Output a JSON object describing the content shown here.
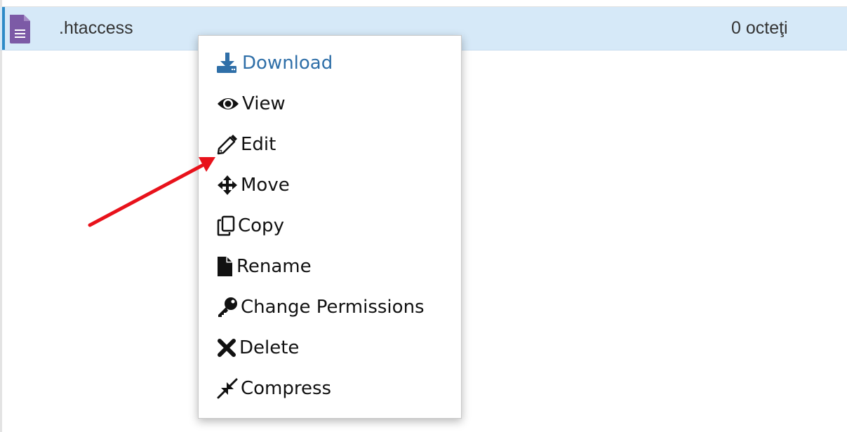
{
  "file_row": {
    "name": ".htaccess",
    "size": "0 octeţi",
    "icon": "text-file-icon"
  },
  "context_menu": {
    "items": [
      {
        "label": "Download",
        "icon": "download-icon",
        "active": true
      },
      {
        "label": "View",
        "icon": "eye-icon",
        "active": false
      },
      {
        "label": "Edit",
        "icon": "pencil-icon",
        "active": false
      },
      {
        "label": "Move",
        "icon": "move-arrows-icon",
        "active": false
      },
      {
        "label": "Copy",
        "icon": "copy-icon",
        "active": false
      },
      {
        "label": "Rename",
        "icon": "file-icon",
        "active": false
      },
      {
        "label": "Change Permissions",
        "icon": "key-icon",
        "active": false
      },
      {
        "label": "Delete",
        "icon": "x-icon",
        "active": false
      },
      {
        "label": "Compress",
        "icon": "compress-icon",
        "active": false
      }
    ]
  },
  "annotation": {
    "arrow_color": "#e8121b"
  },
  "colors": {
    "row_highlight": "#d6e9f8",
    "row_accent": "#2d8ac7",
    "active_item": "#2f6fa8",
    "file_icon": "#7c5aa6"
  }
}
